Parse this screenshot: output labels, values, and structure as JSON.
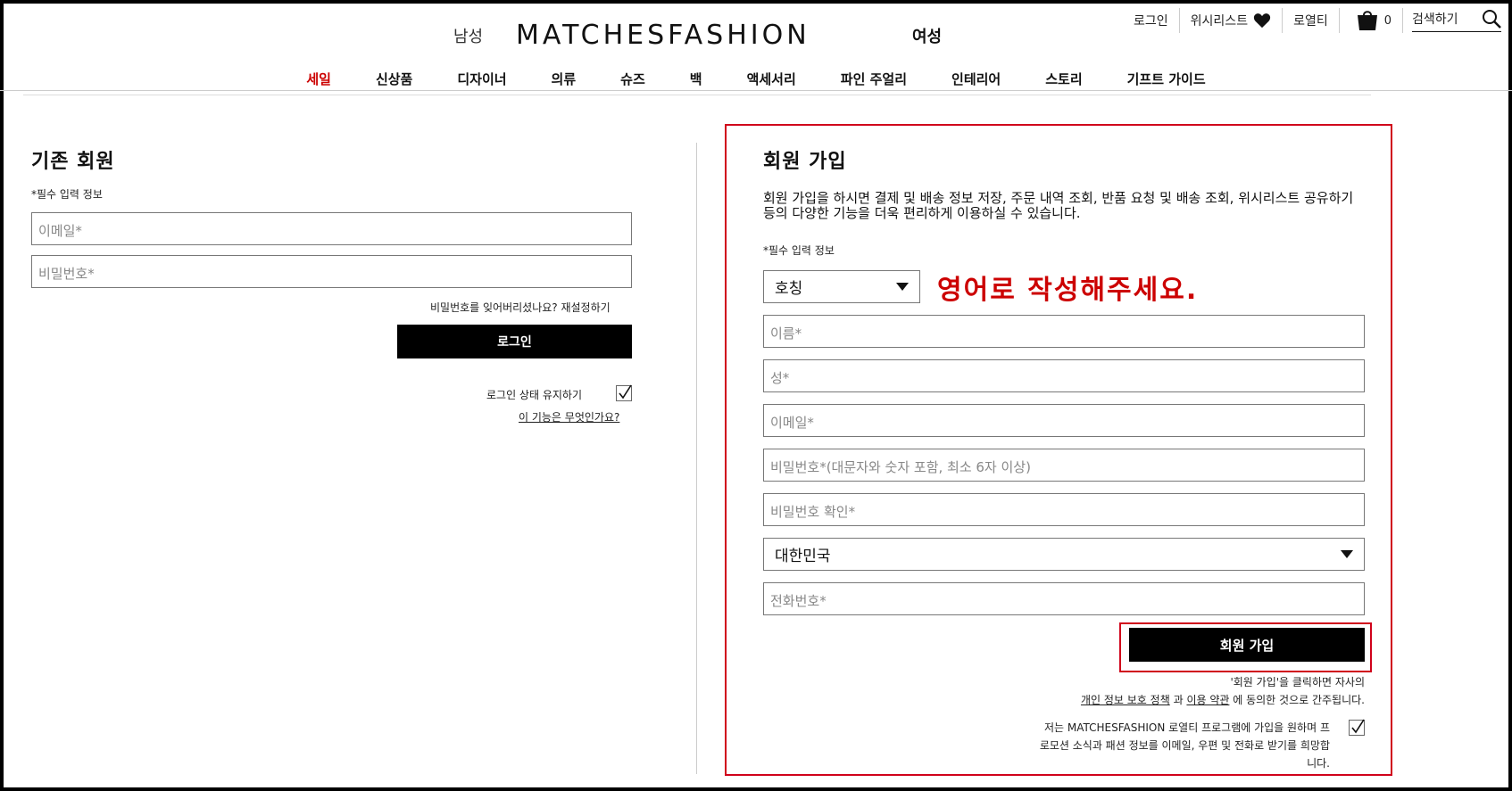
{
  "header": {
    "men": "남성",
    "women": "여성",
    "logo": "MATCHESFASHION",
    "utility": {
      "login": "로그인",
      "wishlist": "위시리스트",
      "loyalty": "로열티",
      "cart_count": "0",
      "search_placeholder": "검색하기"
    }
  },
  "nav": {
    "items": [
      "세일",
      "신상품",
      "디자이너",
      "의류",
      "슈즈",
      "백",
      "액세서리",
      "파인 주얼리",
      "인테리어",
      "스토리",
      "기프트 가이드"
    ]
  },
  "login": {
    "title": "기존 회원",
    "required_note": "*필수 입력 정보",
    "email_placeholder": "이메일*",
    "password_placeholder": "비밀번호*",
    "forgot": "비밀번호를 잊어버리셨나요? 재설정하기",
    "button": "로그인",
    "remember": "로그인 상태 유지하기",
    "what_is": "이 기능은 무엇인가요?"
  },
  "register": {
    "title": "회원 가입",
    "description": "회원 가입을 하시면 결제 및 배송 정보 저장, 주문 내역 조회, 반품 요청 및 배송 조회, 위시리스트 공유하기 등의 다양한 기능을 더욱 편리하게 이용하실 수 있습니다.",
    "required_note": "*필수 입력 정보",
    "title_select": "호칭",
    "note": "영어로 작성해주세요.",
    "first_name": "이름*",
    "last_name": "성*",
    "email": "이메일*",
    "password": "비밀번호*(대문자와 숫자 포함, 최소 6자 이상)",
    "password_confirm": "비밀번호 확인*",
    "country": "대한민국",
    "phone": "전화번호*",
    "button": "회원 가입",
    "terms_line1": "'회원 가입'을 클릭하면 자사의",
    "privacy_link": "개인 정보 보호 정책",
    "terms_and": "과",
    "terms_link": "이용 약관",
    "terms_end": "에 동의한 것으로 간주됩니다.",
    "loyalty_text": "저는 MATCHESFASHION 로열티 프로그램에 가입을 원하며 프로모션 소식과 패션 정보를 이메일, 우편 및 전화로 받기를 희망합니다."
  },
  "colors": {
    "accent_red": "#d0021b",
    "sale_red": "#cc0000",
    "button_black": "#000000"
  }
}
